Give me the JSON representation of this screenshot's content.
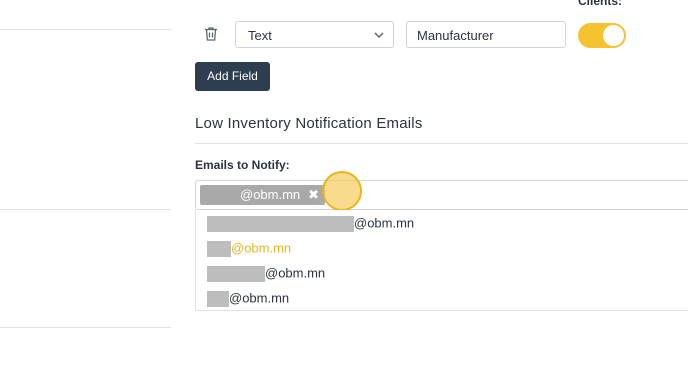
{
  "field_row": {
    "clients_label": "Clients:",
    "type_select": {
      "value": "Text"
    },
    "name_input": {
      "value": "Manufacturer"
    },
    "toggle_on": true
  },
  "add_field_button": "Add Field",
  "section": {
    "title": "Low Inventory Notification Emails",
    "emails_label": "Emails to Notify:"
  },
  "selected_chip": {
    "domain": "@obm.mn",
    "remove_icon": "close-icon"
  },
  "options": [
    {
      "domain": "@obm.mn",
      "highlighted": false
    },
    {
      "domain": "@obm.mn",
      "highlighted": true
    },
    {
      "domain": "@obm.mn",
      "highlighted": false
    },
    {
      "domain": "@obm.mn",
      "highlighted": false
    }
  ],
  "colors": {
    "accent": "#f5c230",
    "button_bg": "#2d3e50",
    "highlight_text": "#e8b521",
    "redacted": "#bdbdbd"
  }
}
